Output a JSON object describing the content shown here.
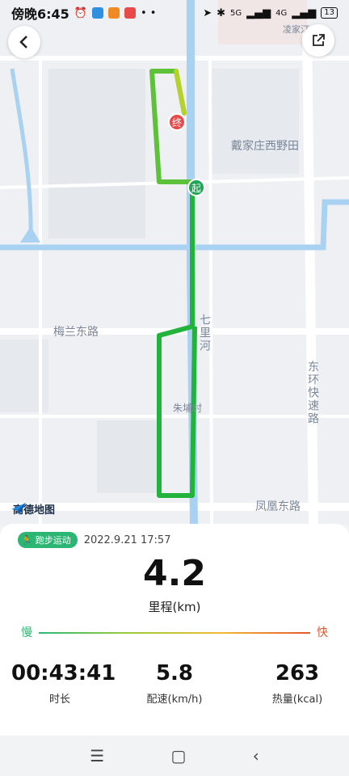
{
  "status_bar": {
    "time": "傍晚6:45",
    "network_1": "5G",
    "network_2": "4G",
    "battery": "13",
    "dots": "• •"
  },
  "map": {
    "labels": {
      "daijia": "戴家庄西野田",
      "meilan": "梅兰东路",
      "qili": "七里河",
      "zhubei": "朱埔村",
      "donghuan": "东环快速路",
      "fenghuang": "凤凰东路",
      "top_right": "凌家汀"
    },
    "start_marker": "起",
    "end_marker": "终",
    "provider": "高德地图",
    "route_color": "#22b33c",
    "route_end_color": "#b7d12b"
  },
  "panel": {
    "sport_type": "跑步运动",
    "date": "2022.9.21 17:57",
    "distance": "4.2",
    "distance_label": "里程(km)",
    "slow": "慢",
    "fast": "快",
    "stats": [
      {
        "value": "00:43:41",
        "label": "时长"
      },
      {
        "value": "5.8",
        "label": "配速(km/h)"
      },
      {
        "value": "263",
        "label": "热量(kcal)"
      }
    ]
  },
  "colors": {
    "accent": "#2bb673",
    "fast": "#e4572e"
  }
}
